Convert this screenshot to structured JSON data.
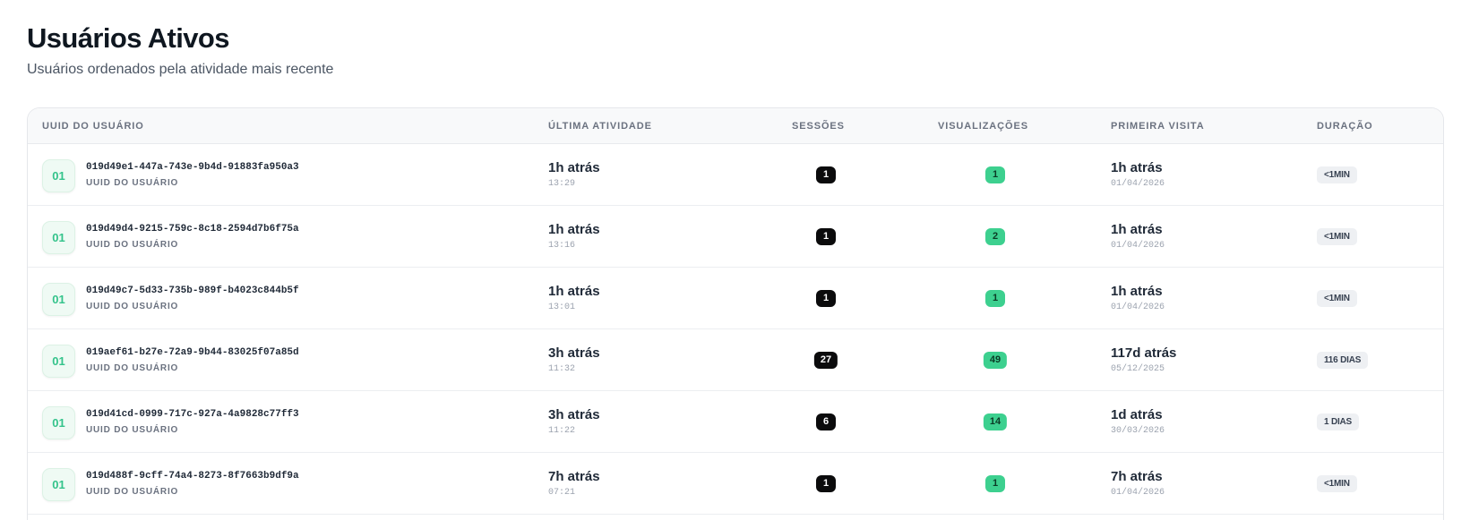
{
  "header": {
    "title": "Usuários Ativos",
    "subtitle": "Usuários ordenados pela atividade mais recente"
  },
  "table": {
    "columns": {
      "uuid": "UUID DO USUÁRIO",
      "last_activity": "ÚLTIMA ATIVIDADE",
      "sessions": "SESSÕES",
      "views": "VISUALIZAÇÕES",
      "first_visit": "PRIMEIRA VISITA",
      "duration": "DURAÇÃO"
    },
    "rows": [
      {
        "avatar": "01",
        "uuid": "019d49e1-447a-743e-9b4d-91883fa950a3",
        "uuid_label": "UUID DO USUÁRIO",
        "last_activity": "1h atrás",
        "last_activity_time": "13:29",
        "sessions": "1",
        "views": "1",
        "first_visit": "1h atrás",
        "first_visit_date": "01/04/2026",
        "duration": "<1MIN"
      },
      {
        "avatar": "01",
        "uuid": "019d49d4-9215-759c-8c18-2594d7b6f75a",
        "uuid_label": "UUID DO USUÁRIO",
        "last_activity": "1h atrás",
        "last_activity_time": "13:16",
        "sessions": "1",
        "views": "2",
        "first_visit": "1h atrás",
        "first_visit_date": "01/04/2026",
        "duration": "<1MIN"
      },
      {
        "avatar": "01",
        "uuid": "019d49c7-5d33-735b-989f-b4023c844b5f",
        "uuid_label": "UUID DO USUÁRIO",
        "last_activity": "1h atrás",
        "last_activity_time": "13:01",
        "sessions": "1",
        "views": "1",
        "first_visit": "1h atrás",
        "first_visit_date": "01/04/2026",
        "duration": "<1MIN"
      },
      {
        "avatar": "01",
        "uuid": "019aef61-b27e-72a9-9b44-83025f07a85d",
        "uuid_label": "UUID DO USUÁRIO",
        "last_activity": "3h atrás",
        "last_activity_time": "11:32",
        "sessions": "27",
        "views": "49",
        "first_visit": "117d atrás",
        "first_visit_date": "05/12/2025",
        "duration": "116 DIAS"
      },
      {
        "avatar": "01",
        "uuid": "019d41cd-0999-717c-927a-4a9828c77ff3",
        "uuid_label": "UUID DO USUÁRIO",
        "last_activity": "3h atrás",
        "last_activity_time": "11:22",
        "sessions": "6",
        "views": "14",
        "first_visit": "1d atrás",
        "first_visit_date": "30/03/2026",
        "duration": "1 DIAS"
      },
      {
        "avatar": "01",
        "uuid": "019d488f-9cff-74a4-8273-8f7663b9df9a",
        "uuid_label": "UUID DO USUÁRIO",
        "last_activity": "7h atrás",
        "last_activity_time": "07:21",
        "sessions": "1",
        "views": "1",
        "first_visit": "7h atrás",
        "first_visit_date": "01/04/2026",
        "duration": "<1MIN"
      }
    ]
  },
  "colors": {
    "sessions_badge": "#0b0b0c",
    "views_badge": "#3dd08f",
    "avatar_text": "#34c38b"
  }
}
